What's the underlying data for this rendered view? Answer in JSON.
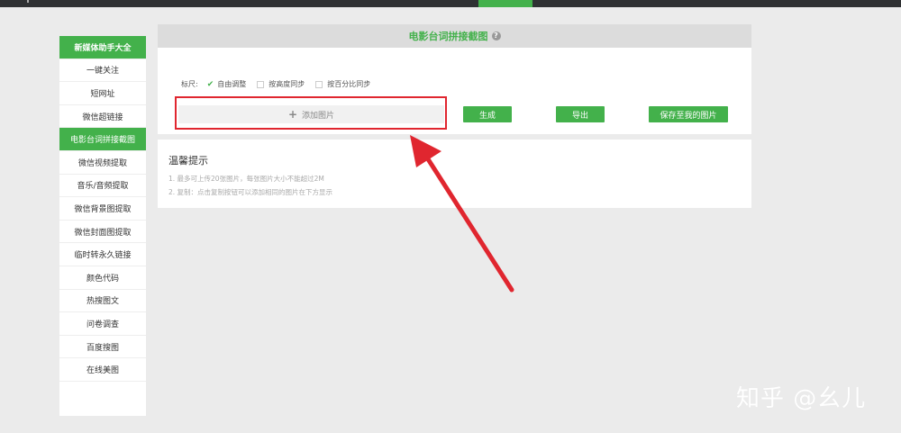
{
  "sidebar": {
    "items": [
      {
        "label": "新媒体助手大全"
      },
      {
        "label": "一键关注"
      },
      {
        "label": "短网址"
      },
      {
        "label": "微信超链接"
      },
      {
        "label": "电影台词拼接截图"
      },
      {
        "label": "微信视频提取"
      },
      {
        "label": "音乐/音频提取"
      },
      {
        "label": "微信背景图提取"
      },
      {
        "label": "微信封面图提取"
      },
      {
        "label": "临时转永久链接"
      },
      {
        "label": "颜色代码"
      },
      {
        "label": "热搜图文"
      },
      {
        "label": "问卷调查"
      },
      {
        "label": "百度搜图"
      },
      {
        "label": "在线美图"
      }
    ]
  },
  "panel": {
    "title": "电影台词拼接截图",
    "help_icon": "?",
    "ruler_label": "标尺:",
    "options": [
      "自由调整",
      "按高度同步",
      "按百分比同步"
    ],
    "add_image_label": "添加图片",
    "generate_label": "生成",
    "export_label": "导出",
    "save_label": "保存至我的图片"
  },
  "tips": {
    "title": "温馨提示",
    "line1": "1. 最多可上传20张图片，每张图片大小不能超过2M",
    "line2": "2. 复制：点击复制按钮可以添加相同的图片在下方显示"
  },
  "watermark": "知乎 @幺儿",
  "colors": {
    "accent": "#43b14b",
    "highlight": "#e0262f",
    "topbar": "#2f3133"
  }
}
